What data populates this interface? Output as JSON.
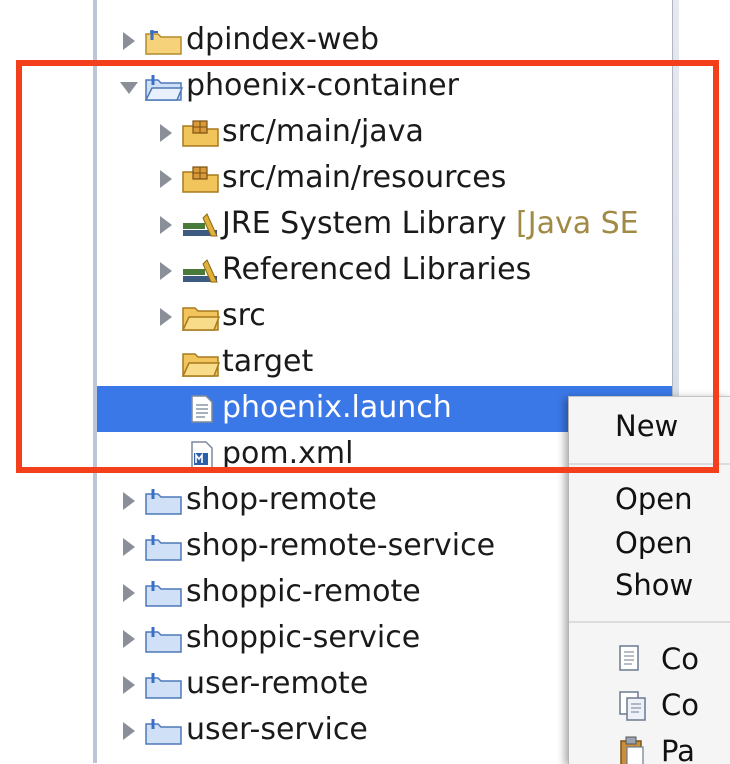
{
  "tree": {
    "items": [
      {
        "label": "dpindex-web",
        "suffix": "",
        "icon": "project-folder-icon",
        "expander": "collapsed"
      },
      {
        "label": "phoenix-container",
        "suffix": "",
        "icon": "project-folder-icon",
        "expander": "expanded"
      },
      {
        "label": "src/main/java",
        "suffix": "",
        "icon": "package-folder-icon",
        "expander": "collapsed"
      },
      {
        "label": "src/main/resources",
        "suffix": "",
        "icon": "package-folder-icon",
        "expander": "collapsed"
      },
      {
        "label": "JRE System Library ",
        "suffix": "[Java SE",
        "icon": "library-icon",
        "expander": "collapsed"
      },
      {
        "label": "Referenced Libraries",
        "suffix": "",
        "icon": "library-icon",
        "expander": "collapsed"
      },
      {
        "label": "src",
        "suffix": "",
        "icon": "folder-icon",
        "expander": "collapsed"
      },
      {
        "label": "target",
        "suffix": "",
        "icon": "folder-icon",
        "expander": "none"
      },
      {
        "label": "phoenix.launch",
        "suffix": "",
        "icon": "launch-file-icon",
        "expander": "none",
        "selected": true
      },
      {
        "label": "pom.xml",
        "suffix": "",
        "icon": "maven-file-icon",
        "expander": "none"
      },
      {
        "label": "shop-remote",
        "suffix": "",
        "icon": "project-folder-icon",
        "expander": "collapsed"
      },
      {
        "label": "shop-remote-service",
        "suffix": "",
        "icon": "project-folder-icon",
        "expander": "collapsed"
      },
      {
        "label": "shoppic-remote",
        "suffix": "",
        "icon": "project-folder-icon",
        "expander": "collapsed"
      },
      {
        "label": "shoppic-service",
        "suffix": "",
        "icon": "project-folder-icon",
        "expander": "collapsed"
      },
      {
        "label": "user-remote",
        "suffix": "",
        "icon": "project-folder-icon",
        "expander": "collapsed"
      },
      {
        "label": "user-service",
        "suffix": "",
        "icon": "project-folder-icon",
        "expander": "collapsed"
      }
    ]
  },
  "context_menu": {
    "new_label": "New",
    "open_label": "Open",
    "open_with_label": "Open",
    "show_in_label": "Show",
    "copy_label": "Co",
    "copy_qualified_label": "Co",
    "paste_label": "Pa"
  },
  "colors": {
    "selection": "#3b78e7",
    "highlight_border": "#f43f1c",
    "folder": "#f2c55c"
  }
}
